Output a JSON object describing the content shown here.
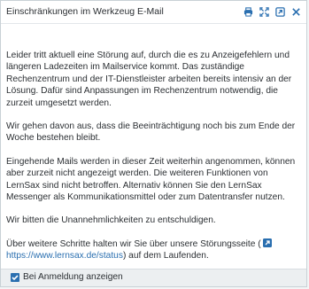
{
  "dialog": {
    "title": "Einschränkungen im Werkzeug E-Mail",
    "icons": [
      "print-icon",
      "fullscreen-icon",
      "open-external-icon",
      "close-icon"
    ]
  },
  "content": {
    "p1": "Leider tritt aktuell eine Störung auf, durch die es zu Anzeigefehlern und längeren Ladezeiten im Mailservice kommt. Das zuständige Rechenzentrum und der IT-Dienstleister arbeiten bereits intensiv an der Lösung. Dafür sind Anpassungen im Rechenzentrum notwendig, die zurzeit umgesetzt werden.",
    "p2": "Wir gehen davon aus, dass die Beeinträchtigung noch bis zum Ende der Woche bestehen bleibt.",
    "p3": "Eingehende Mails werden in dieser Zeit weiterhin angenommen, können aber zurzeit nicht angezeigt werden. Die weiteren Funktionen von LernSax sind nicht betroffen. Alternativ können Sie den LernSax Messenger als Kommunikationsmittel oder zum Datentransfer nutzen.",
    "p4": "Wir bitten die Unannehmlichkeiten zu entschuldigen.",
    "p5_before": "Über weitere Schritte halten wir Sie über unsere Störungsseite (",
    "p5_link": "https://www.lernsax.de/status",
    "p5_after": ") auf dem Laufenden."
  },
  "footer": {
    "checkbox_label": "Bei Anmeldung anzeigen",
    "checkbox_checked": true
  },
  "colors": {
    "accent": "#2a6fb0",
    "text": "#2b2f33",
    "footer_bg": "#eceff1"
  }
}
